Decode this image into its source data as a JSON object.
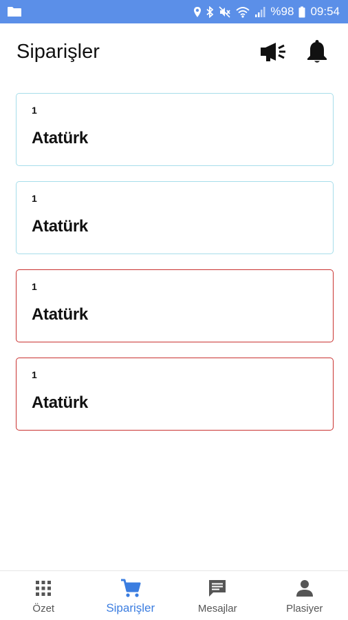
{
  "status_bar": {
    "battery_text": "%98",
    "time": "09:54",
    "color": "#5b8fe8",
    "icons": [
      "folder-icon",
      "location-icon",
      "bluetooth-icon",
      "mute-icon",
      "wifi-icon",
      "signal-icon",
      "battery-icon"
    ]
  },
  "header": {
    "title": "Siparişler",
    "actions": [
      "megaphone-icon",
      "bell-icon"
    ]
  },
  "orders": [
    {
      "number": "1",
      "name": "Atatürk",
      "status_color": "#a6ddea"
    },
    {
      "number": "1",
      "name": "Atatürk",
      "status_color": "#a6ddea"
    },
    {
      "number": "1",
      "name": "Atatürk",
      "status_color": "#c9312f"
    },
    {
      "number": "1",
      "name": "Atatürk",
      "status_color": "#c9312f"
    }
  ],
  "bottom_nav": {
    "active_color": "#3b7de0",
    "items": [
      {
        "label": "Özet",
        "icon": "grid-icon",
        "active": false
      },
      {
        "label": "Siparişler",
        "icon": "cart-icon",
        "active": true
      },
      {
        "label": "Mesajlar",
        "icon": "message-icon",
        "active": false
      },
      {
        "label": "Plasiyer",
        "icon": "person-icon",
        "active": false
      }
    ]
  }
}
